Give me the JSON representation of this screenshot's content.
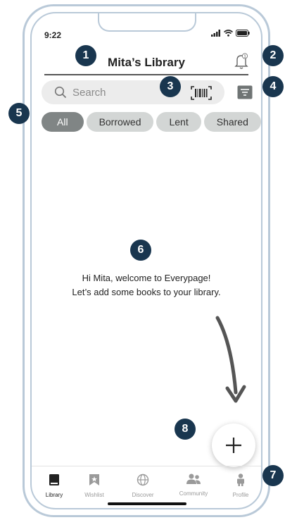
{
  "status": {
    "time": "9:22"
  },
  "header": {
    "title": "Mita’s Library",
    "notification_count": "1"
  },
  "search": {
    "placeholder": "Search"
  },
  "filters": [
    "All",
    "Borrowed",
    "Lent",
    "Shared"
  ],
  "empty_state": {
    "line1": "Hi Mita, welcome to Everypage!",
    "line2": "Let’s add some books to your library."
  },
  "tabs": [
    {
      "label": "Library",
      "icon": "book-icon"
    },
    {
      "label": "Wishlist",
      "icon": "bookmark-star-icon"
    },
    {
      "label": "Discover",
      "icon": "globe-icon"
    },
    {
      "label": "Community",
      "icon": "people-icon"
    },
    {
      "label": "Profile",
      "icon": "person-icon"
    }
  ],
  "annotations": [
    "1",
    "2",
    "3",
    "4",
    "5",
    "6",
    "7",
    "8"
  ],
  "colors": {
    "badge": "#19364f",
    "chip_active": "#808585",
    "chip": "#d3d6d5",
    "frame": "#b9c9d8"
  }
}
